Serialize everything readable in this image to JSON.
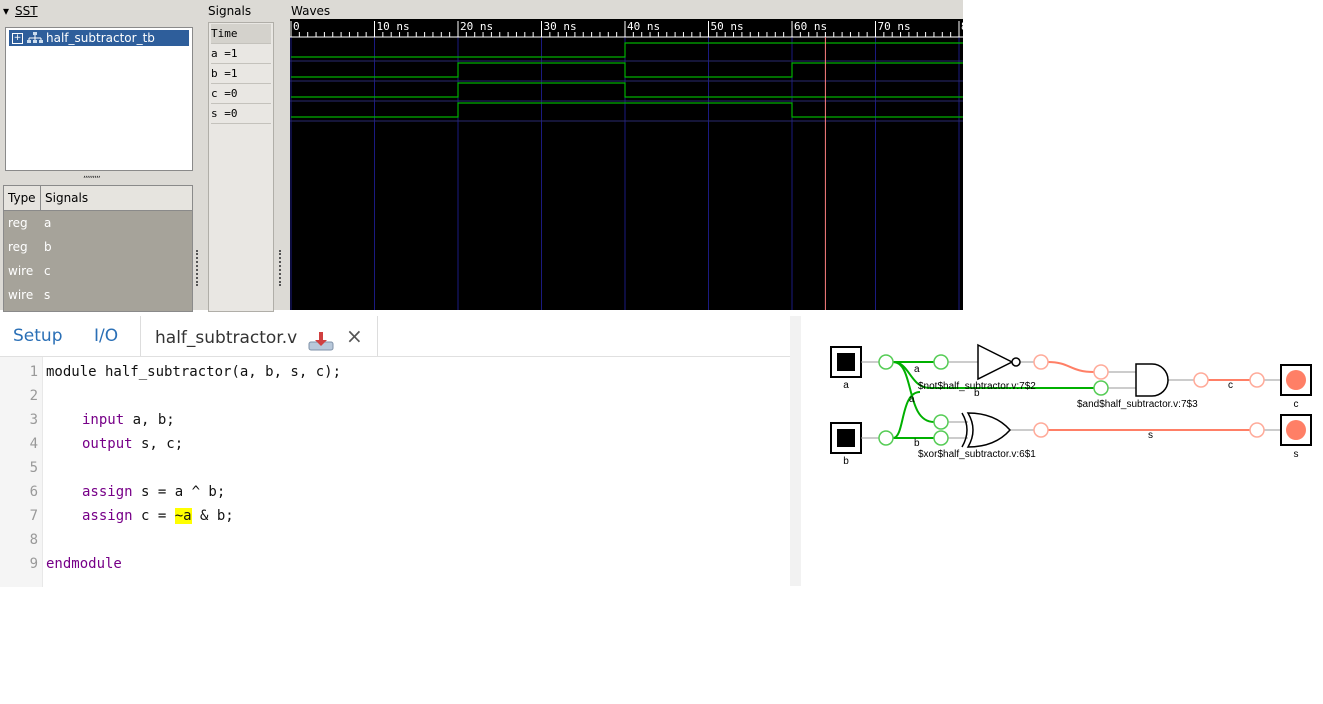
{
  "gtkwave": {
    "sst_label": "SST",
    "tree_item": "half_subtractor_tb",
    "grip": ",,,,,,,,,",
    "types_header": {
      "type": "Type",
      "signals": "Signals"
    },
    "signal_rows": [
      {
        "type": "reg",
        "name": "a"
      },
      {
        "type": "reg",
        "name": "b"
      },
      {
        "type": "wire",
        "name": "c"
      },
      {
        "type": "wire",
        "name": "s"
      }
    ],
    "signals_label": "Signals",
    "waves_label": "Waves",
    "signal_names": [
      "Time",
      "a =1",
      "b =1",
      "c =0",
      "s =0"
    ],
    "time_ticks": [
      "0",
      "10 ns",
      "20 ns",
      "30 ns",
      "40 ns",
      "50 ns",
      "60 ns",
      "70 ns",
      "80 n"
    ],
    "marker_time_ns": 64,
    "waveforms": {
      "a": [
        [
          0,
          0
        ],
        [
          40,
          1
        ]
      ],
      "b": [
        [
          0,
          0
        ],
        [
          20,
          1
        ],
        [
          40,
          0
        ],
        [
          60,
          1
        ]
      ],
      "c": [
        [
          0,
          0
        ],
        [
          20,
          1
        ],
        [
          40,
          0
        ]
      ],
      "s": [
        [
          0,
          0
        ],
        [
          20,
          1
        ],
        [
          60,
          0
        ]
      ]
    }
  },
  "editor": {
    "tabs": {
      "setup": "Setup",
      "io": "I/O",
      "file": "half_subtractor.v",
      "close": "×"
    },
    "lines": [
      {
        "n": "1",
        "text": "module half_subtractor(a, b, s, c);"
      },
      {
        "n": "2",
        "text": ""
      },
      {
        "n": "3",
        "kw": "input",
        "rest": " a, b;"
      },
      {
        "n": "4",
        "kw": "output",
        "rest": " s, c;"
      },
      {
        "n": "5",
        "text": ""
      },
      {
        "n": "6",
        "kw": "assign",
        "rest": " s = a ^ b;"
      },
      {
        "n": "7",
        "kw": "assign",
        "rest": " c = ",
        "hl": "~a",
        "tail": " & b;"
      },
      {
        "n": "8",
        "text": ""
      },
      {
        "n": "9",
        "kw": "endmodule",
        "rest": ""
      }
    ]
  },
  "schematic": {
    "inputs": [
      "a",
      "b"
    ],
    "outputs": [
      "c",
      "s"
    ],
    "wire_labels": [
      "a",
      "b",
      "a",
      "b",
      "c",
      "s"
    ],
    "cells": [
      "$not$half_subtractor.v:7$2",
      "$and$half_subtractor.v:7$3",
      "$xor$half_subtractor.v:6$1"
    ],
    "colors": {
      "high": "#00b000",
      "low": "#ff7f66",
      "grid": "#1a1a80",
      "marker": "#ff8080"
    }
  }
}
